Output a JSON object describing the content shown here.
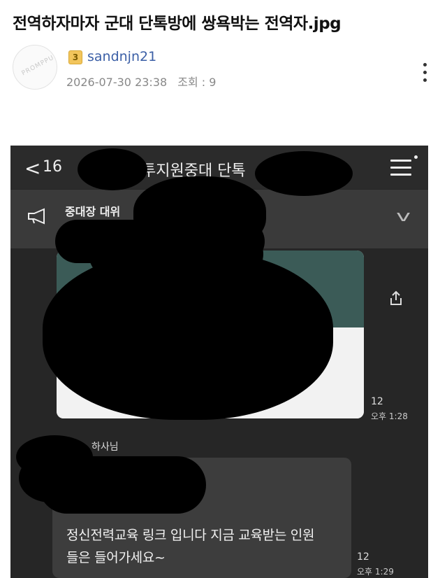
{
  "post": {
    "title": "전역하자마자 군대 단톡방에 쌍욕박는 전역자.jpg",
    "author": "sandnjn21",
    "level": "3",
    "avatar_text": "PROMPPU",
    "date": "2026-07-30 23:38",
    "views_label": "조회 : 9"
  },
  "chat": {
    "back_chevron": "<",
    "back_count": "16",
    "room_title": "투지원중대 단톡",
    "notice_text": "중대장 대위",
    "notice_chevron": "v",
    "image_msg": {
      "read_count": "12",
      "time": "오후 1:28"
    },
    "sender_name": "하사님",
    "text_msg": {
      "line1": "정신전력교육 링크 입니다 지금 교육받는 인원",
      "line2": "들은 들어가세요~",
      "read_count": "12",
      "time": "오후 1:29"
    }
  },
  "colors": {
    "author": "#3b5fa6",
    "chat_bg": "#262626",
    "bubble": "#3d3d3d",
    "redaction": "#000000"
  },
  "icons": [
    "level-badge-icon",
    "more-menu-icon",
    "back-chevron-icon",
    "hamburger-menu-icon",
    "megaphone-icon",
    "chevron-down-icon",
    "share-icon"
  ]
}
